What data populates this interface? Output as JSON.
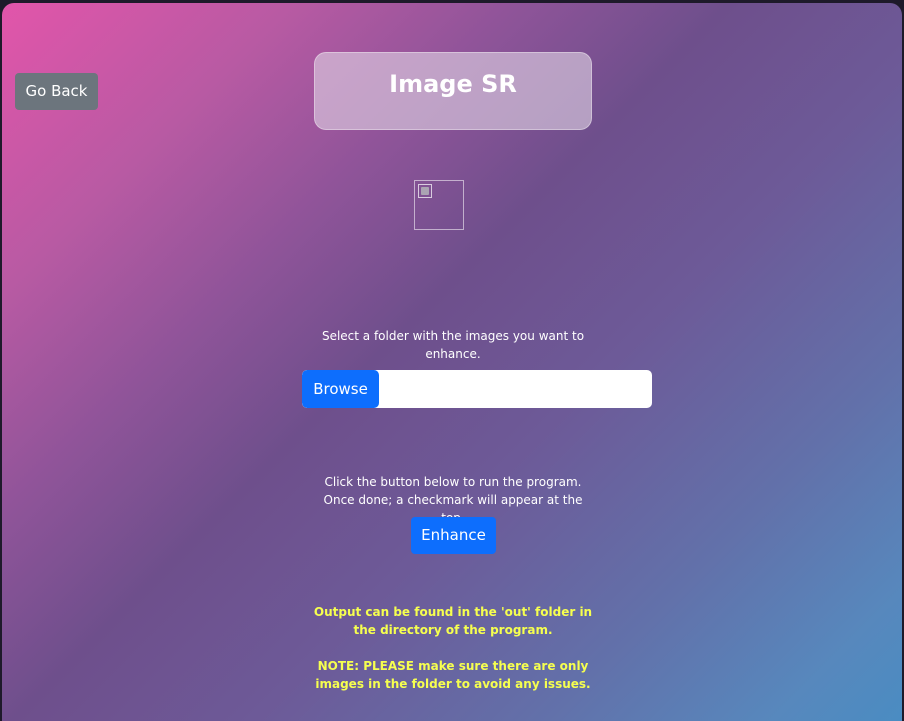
{
  "nav": {
    "back_label": "Go Back"
  },
  "header": {
    "title": "Image SR"
  },
  "preview": {
    "icon": "broken-image-icon"
  },
  "folder_select": {
    "instructions": "Select a folder with the images you want to enhance.",
    "browse_label": "Browse",
    "selected_path": ""
  },
  "run": {
    "instructions": "Click the button below to run the program. Once done; a checkmark will appear at the top.",
    "enhance_label": "Enhance"
  },
  "notes": {
    "output": "Output can be found in the 'out' folder in the directory of the program.",
    "warning": "NOTE: PLEASE make sure there are only images in the folder to avoid any issues."
  },
  "colors": {
    "primary_button": "#0d6efd",
    "secondary_button": "#6c757d",
    "note_text": "#f6ff4f"
  }
}
